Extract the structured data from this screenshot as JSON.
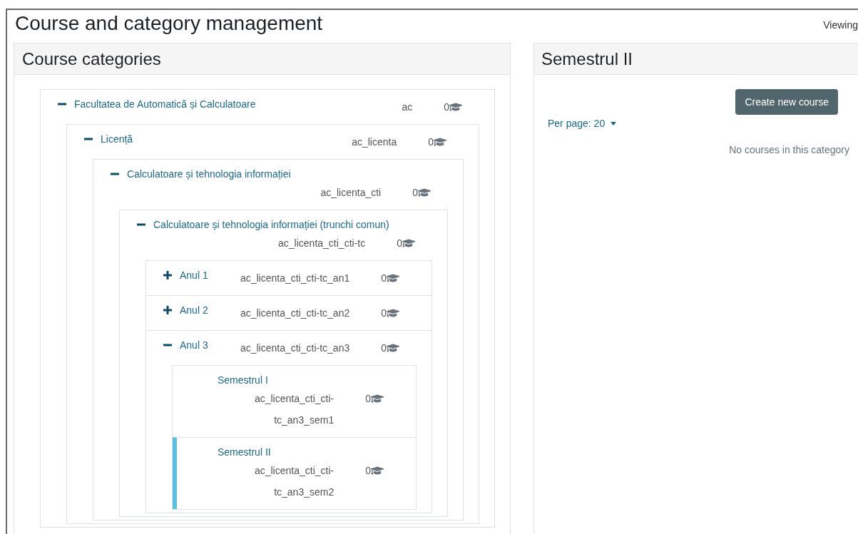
{
  "page": {
    "title": "Course and category management",
    "viewing_label": "Viewing"
  },
  "categories_panel": {
    "title": "Course categories",
    "categories": [
      {
        "name": "Facultatea de Automatică și Calculatoare",
        "idnumber": "ac",
        "course_count": "0",
        "expanded": true,
        "selected": false,
        "children": [
          {
            "name": "Licență",
            "idnumber": "ac_licenta",
            "course_count": "0",
            "expanded": true,
            "selected": false,
            "children": [
              {
                "name": "Calculatoare și tehnologia informației",
                "idnumber": "ac_licenta_cti",
                "course_count": "0",
                "expanded": true,
                "selected": false,
                "children": [
                  {
                    "name": "Calculatoare și tehnologia informației (trunchi comun)",
                    "idnumber": "ac_licenta_cti_cti-tc",
                    "course_count": "0",
                    "expanded": true,
                    "selected": false,
                    "children": [
                      {
                        "name": "Anul 1",
                        "idnumber": "ac_licenta_cti_cti-tc_an1",
                        "course_count": "0",
                        "expanded": false,
                        "selected": false
                      },
                      {
                        "name": "Anul 2",
                        "idnumber": "ac_licenta_cti_cti-tc_an2",
                        "course_count": "0",
                        "expanded": false,
                        "selected": false
                      },
                      {
                        "name": "Anul 3",
                        "idnumber": "ac_licenta_cti_cti-tc_an3",
                        "course_count": "0",
                        "expanded": true,
                        "selected": false,
                        "children": [
                          {
                            "name": "Semestrul I",
                            "idnumber": "ac_licenta_cti_cti-tc_an3_sem1",
                            "course_count": "0",
                            "selected": false
                          },
                          {
                            "name": "Semestrul II",
                            "idnumber": "ac_licenta_cti_cti-tc_an3_sem2",
                            "course_count": "0",
                            "selected": true
                          }
                        ]
                      }
                    ]
                  }
                ]
              }
            ]
          }
        ]
      }
    ]
  },
  "courses_panel": {
    "title": "Semestrul II",
    "create_button": "Create new course",
    "per_page": "Per page: 20",
    "empty_message": "No courses in this category"
  }
}
